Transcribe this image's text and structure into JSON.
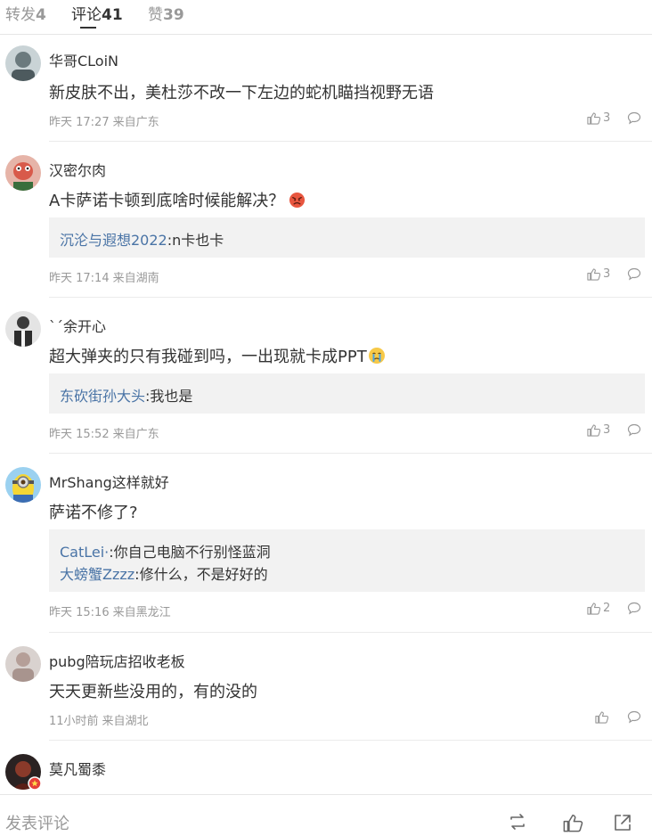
{
  "tabs": [
    {
      "label": "转发",
      "count": "4"
    },
    {
      "label": "评论",
      "count": "41"
    },
    {
      "label": "赞",
      "count": "39"
    }
  ],
  "comments": [
    {
      "name": "华哥CLoiN",
      "text": "新皮肤不出，美杜莎不改一下左边的蛇机瞄挡视野无语",
      "time": "昨天 17:27",
      "location": "来自广东",
      "likes": "3",
      "replies": []
    },
    {
      "name": "汉密尔肉",
      "text": "A卡萨诺卡顿到底啥时候能解决？",
      "time": "昨天 17:14",
      "location": "来自湖南",
      "likes": "3",
      "replies": [
        {
          "user": "沉沦与遐想2022",
          "text": ":n卡也卡"
        }
      ]
    },
    {
      "name": "ˋˊ余开心",
      "text": "超大弹夹的只有我碰到吗，一出现就卡成PPT",
      "time": "昨天 15:52",
      "location": "来自广东",
      "likes": "3",
      "replies": [
        {
          "user": "东砍街孙大头",
          "text": ":我也是"
        }
      ]
    },
    {
      "name": "MrShang这样就好",
      "text": "萨诺不修了?",
      "time": "昨天 15:16",
      "location": "来自黑龙江",
      "likes": "2",
      "replies": [
        {
          "user": "CatLei·",
          "text": ":你自己电脑不行别怪蓝洞"
        },
        {
          "user": "大螃蟹Zzzz",
          "text": ":修什么，不是好好的"
        }
      ]
    },
    {
      "name": "pubg陪玩店招收老板",
      "text": "天天更新些没用的，有的没的",
      "time": "11小时前",
      "location": "来自湖北",
      "likes": "",
      "replies": []
    },
    {
      "name": "莫凡蜀黍",
      "text": "",
      "time": "",
      "location": "",
      "likes": "",
      "replies": []
    }
  ],
  "bottom_bar": {
    "compose_placeholder": "发表评论"
  },
  "colors": {
    "reply_user": "#4a74a6",
    "reply_bg": "#f2f2f2",
    "meta": "#999999"
  }
}
